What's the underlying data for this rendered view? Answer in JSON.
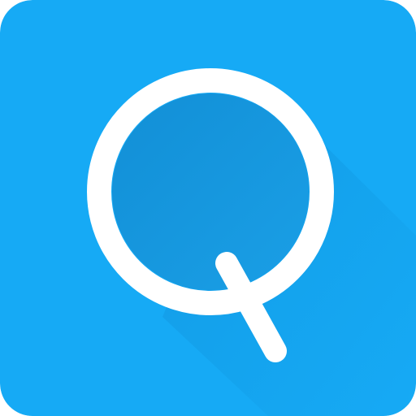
{
  "app_icon": {
    "glyph": "Q",
    "icon_name": "q-letter-icon",
    "colors": {
      "background": "#16aaf5",
      "inner_circle": "#128fd6",
      "inner_circle_light": "#1a9fe6",
      "long_shadow": "#0f8fd8",
      "ring": "#ffffff"
    }
  }
}
